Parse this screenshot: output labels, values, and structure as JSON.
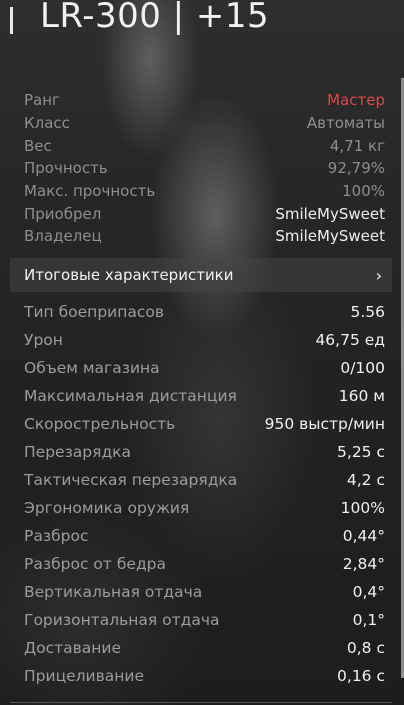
{
  "item": {
    "title": "LR-300 | +15"
  },
  "info": [
    {
      "label": "Ранг",
      "value": "Мастер",
      "style": "rank"
    },
    {
      "label": "Класс",
      "value": "Автоматы",
      "style": "dim"
    },
    {
      "label": "Вес",
      "value": "4,71 кг",
      "style": "dim"
    },
    {
      "label": "Прочность",
      "value": "92,79%",
      "style": "dim"
    },
    {
      "label": "Макс. прочность",
      "value": "100%",
      "style": "dim"
    },
    {
      "label": "Приобрел",
      "value": "SmileMySweet",
      "style": "bright"
    },
    {
      "label": "Владелец",
      "value": "SmileMySweet",
      "style": "bright"
    }
  ],
  "section": {
    "label": "Итоговые характеристики",
    "chevron": "›"
  },
  "stats": [
    {
      "label": "Тип боеприпасов",
      "value": "5.56"
    },
    {
      "label": "Урон",
      "value": "46,75 ед"
    },
    {
      "label": "Объем магазина",
      "value": "0/100"
    },
    {
      "label": "Максимальная дистанция",
      "value": "160 м"
    },
    {
      "label": "Скорострельность",
      "value": "950 выстр/мин"
    },
    {
      "label": "Перезарядка",
      "value": "5,25 с"
    },
    {
      "label": "Тактическая перезарядка",
      "value": "4,2 с"
    },
    {
      "label": "Эргономика оружия",
      "value": "100%"
    },
    {
      "label": "Разброс",
      "value": "0,44°"
    },
    {
      "label": "Разброс от бедра",
      "value": "2,84°"
    },
    {
      "label": "Вертикальная отдача",
      "value": "0,4°"
    },
    {
      "label": "Горизонтальная отдача",
      "value": "0,1°"
    },
    {
      "label": "Доставание",
      "value": "0,8 с"
    },
    {
      "label": "Прицеливание",
      "value": "0,16 с"
    }
  ],
  "colors": {
    "rank": "#e0474c",
    "text_bright": "#f0f0f0",
    "text_dim": "#8e8e8e"
  }
}
